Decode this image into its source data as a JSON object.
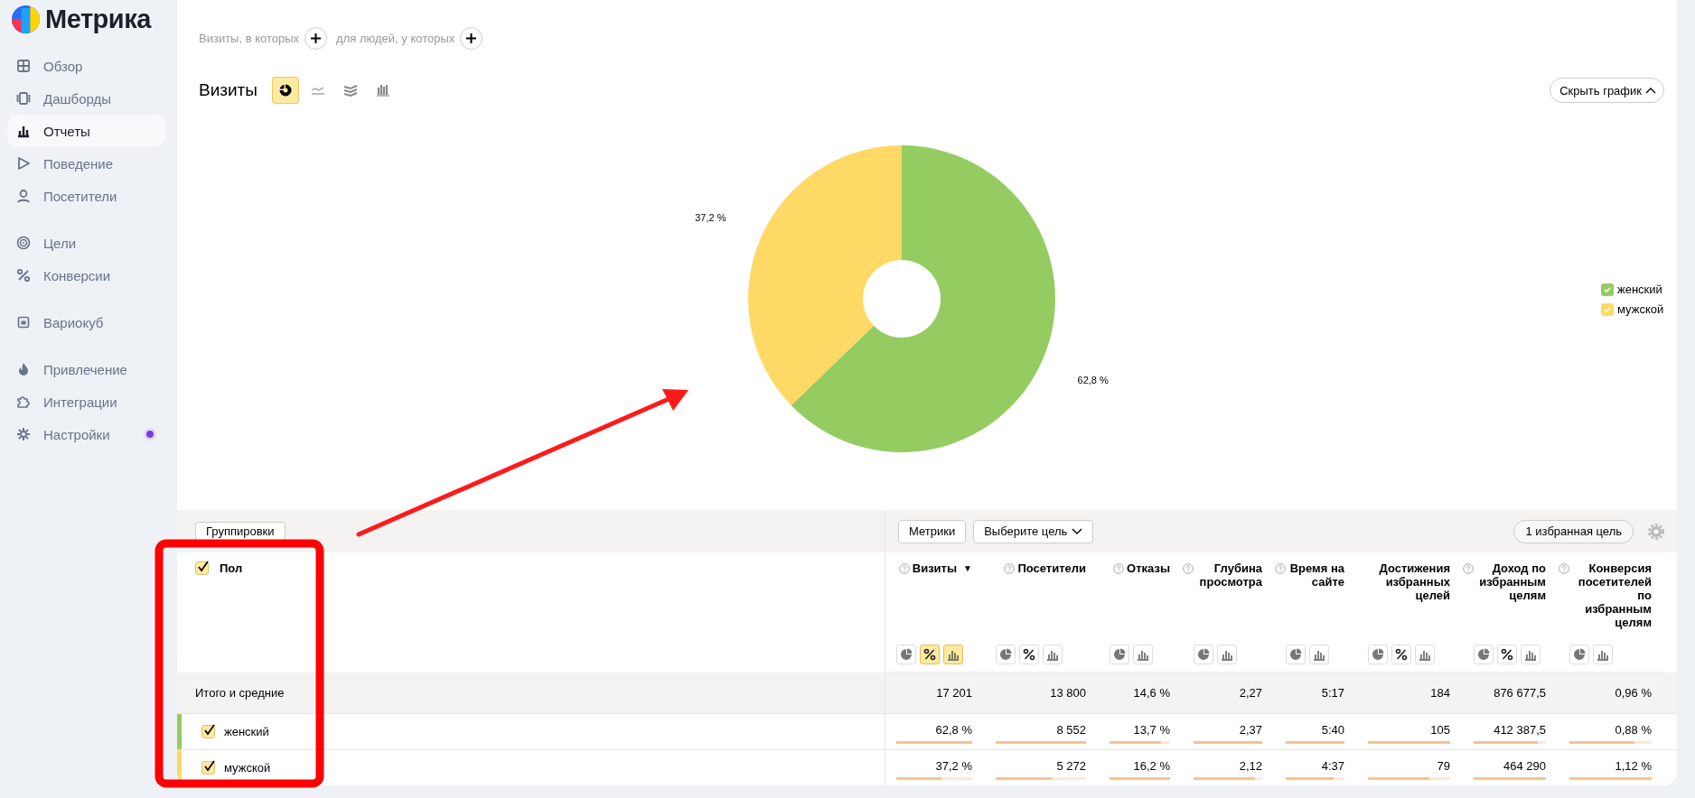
{
  "sidebar": {
    "logo": "Метрика",
    "sections": [
      {
        "items": [
          {
            "label": "Обзор",
            "selected": false,
            "notification": false
          },
          {
            "label": "Дашборды",
            "selected": false,
            "notification": false
          },
          {
            "label": "Отчеты",
            "selected": true,
            "notification": false
          },
          {
            "label": "Поведение",
            "selected": false,
            "notification": false
          },
          {
            "label": "Посетители",
            "selected": false,
            "notification": false
          }
        ]
      },
      {
        "items": [
          {
            "label": "Цели",
            "selected": false,
            "notification": false
          },
          {
            "label": "Конверсии",
            "selected": false,
            "notification": false
          }
        ]
      },
      {
        "items": [
          {
            "label": "Вариокуб",
            "selected": false,
            "notification": false
          }
        ]
      },
      {
        "items": [
          {
            "label": "Привлечение",
            "selected": false,
            "notification": false
          },
          {
            "label": "Интеграции",
            "selected": false,
            "notification": false
          },
          {
            "label": "Настройки",
            "selected": false,
            "notification": true
          }
        ]
      }
    ]
  },
  "filters": [
    {
      "label": "Визиты, в которых"
    },
    {
      "label": "для людей, у которых"
    }
  ],
  "report": {
    "title": "Визиты",
    "chart_types": [
      {
        "kind": "pie",
        "selected": true
      },
      {
        "kind": "line",
        "selected": false
      },
      {
        "kind": "area",
        "selected": false
      },
      {
        "kind": "bar",
        "selected": false
      }
    ],
    "hide_button": "Скрыть график"
  },
  "chart": {
    "chart_data": {
      "type": "donut",
      "categories": [
        "женский",
        "мужской"
      ],
      "values": [
        62.8,
        37.2
      ],
      "data_labels": true,
      "value_labels": [
        "62,8 %",
        "37,2 %"
      ]
    },
    "legend": [
      {
        "color": "#95cc62",
        "checked": true
      },
      {
        "color": "#ffd966",
        "checked": true
      }
    ]
  },
  "table": {
    "toolbar": {
      "groupings": "Группировки",
      "metrics": "Метрики",
      "goal_select": "Выберите цель",
      "favorite_goals": "1 избранная цель"
    },
    "dimension": {
      "label": "Пол",
      "checked": true
    },
    "columns": [
      {
        "label": "Визиты",
        "help": true,
        "sort_mark": "▼",
        "views": [
          {
            "kind": "pie",
            "selected": false
          },
          {
            "kind": "percent",
            "selected": true
          },
          {
            "kind": "bars",
            "selected": true
          }
        ]
      },
      {
        "label": "Посетители",
        "help": true,
        "views": [
          {
            "kind": "pie",
            "selected": false
          },
          {
            "kind": "percent",
            "selected": false
          },
          {
            "kind": "bars",
            "selected": false
          }
        ]
      },
      {
        "label": "Отказы",
        "help": true,
        "views": [
          {
            "kind": "pie",
            "selected": false
          },
          {
            "kind": "bars",
            "selected": false
          }
        ]
      },
      {
        "label": "Глубина просмотра",
        "help": true,
        "views": [
          {
            "kind": "pie",
            "selected": false
          },
          {
            "kind": "bars",
            "selected": false
          }
        ]
      },
      {
        "label": "Время на сайте",
        "help": true,
        "views": [
          {
            "kind": "pie",
            "selected": false
          },
          {
            "kind": "bars",
            "selected": false
          }
        ]
      },
      {
        "label": "Достижения избранных целей",
        "help": false,
        "views": [
          {
            "kind": "pie",
            "selected": false
          },
          {
            "kind": "percent",
            "selected": false
          },
          {
            "kind": "bars",
            "selected": false
          }
        ]
      },
      {
        "label": "Доход по избранным целям",
        "help": true,
        "views": [
          {
            "kind": "pie",
            "selected": false
          },
          {
            "kind": "percent",
            "selected": false
          },
          {
            "kind": "bars",
            "selected": false
          }
        ]
      },
      {
        "label": "Конверсия посетителей по избранным целям",
        "help": true,
        "views": [
          {
            "kind": "pie",
            "selected": false
          },
          {
            "kind": "bars",
            "selected": false
          }
        ]
      }
    ],
    "totals": {
      "label": "Итого и средние",
      "values": [
        "17 201",
        "13 800",
        "14,6 %",
        "2,27",
        "5:17",
        "184",
        "876 677,5",
        "0,96 %"
      ]
    },
    "rows": [
      {
        "label": "женский",
        "checked": true,
        "color": "#95cc62",
        "cells": [
          {
            "value": "62,8 %",
            "level": 1
          },
          {
            "value": "8 552",
            "level": 1
          },
          {
            "value": "13,7 %",
            "level": 0.85
          },
          {
            "value": "2,37",
            "level": 1
          },
          {
            "value": "5:40",
            "level": 1
          },
          {
            "value": "105",
            "level": 1
          },
          {
            "value": "412 387,5",
            "level": 0.89
          },
          {
            "value": "0,88 %",
            "level": 0.79
          }
        ]
      },
      {
        "label": "мужской",
        "checked": true,
        "color": "#ffd966",
        "cells": [
          {
            "value": "37,2 %",
            "level": 0.59
          },
          {
            "value": "5 272",
            "level": 0.62
          },
          {
            "value": "16,2 %",
            "level": 1
          },
          {
            "value": "2,12",
            "level": 0.9
          },
          {
            "value": "4:37",
            "level": 0.82
          },
          {
            "value": "79",
            "level": 0.75
          },
          {
            "value": "464 290",
            "level": 1
          },
          {
            "value": "1,12 %",
            "level": 1
          }
        ]
      }
    ]
  }
}
